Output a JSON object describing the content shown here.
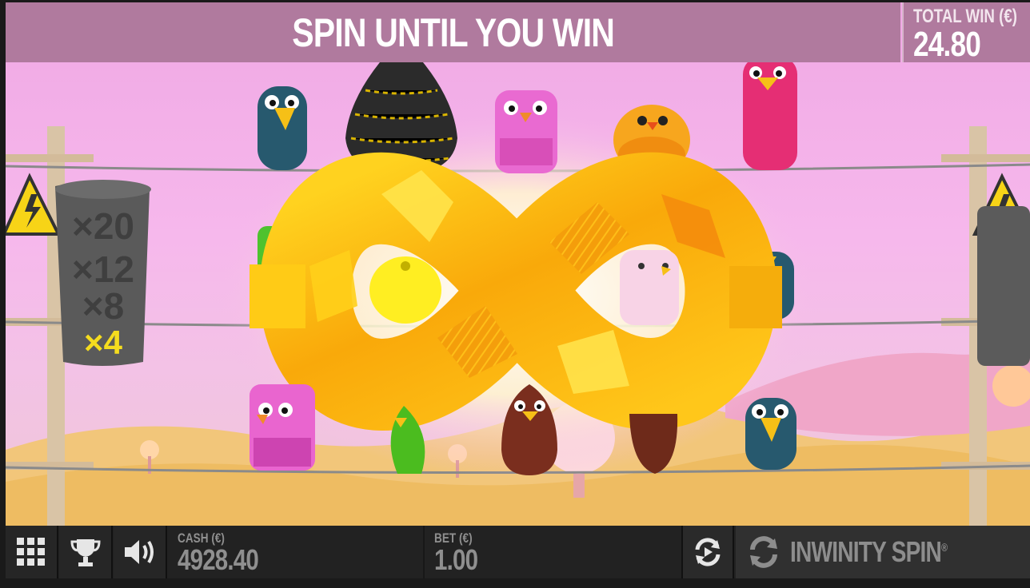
{
  "banner": {
    "message": "SPIN UNTIL YOU WIN"
  },
  "total_win": {
    "label": "TOTAL WIN (€)",
    "value": "24.80"
  },
  "multiplier_meter": {
    "levels": [
      "×20",
      "×12",
      "×8",
      "×4"
    ],
    "active_level": "×4"
  },
  "cash": {
    "label": "CASH (€)",
    "value": "4928.40"
  },
  "bet": {
    "label": "BET (€)",
    "value": "1.00"
  },
  "spin_button": {
    "label": "INWINITY SPIN",
    "trademark": "®"
  },
  "icons": {
    "menu": "grid-menu-icon",
    "trophy": "trophy-icon",
    "sound": "speaker-icon",
    "autoplay": "autoplay-icon",
    "spin": "spin-arrows-icon",
    "hazard": "high-voltage-sign-icon"
  },
  "colors": {
    "banner_bg": "#b07a9e",
    "sky": "#f6b8ec",
    "bottom_bar": "#222222",
    "active_multiplier": "#f5dc1e",
    "inactive_multiplier": "#5a5a5a",
    "infinity_symbol": "#f7b20c"
  }
}
